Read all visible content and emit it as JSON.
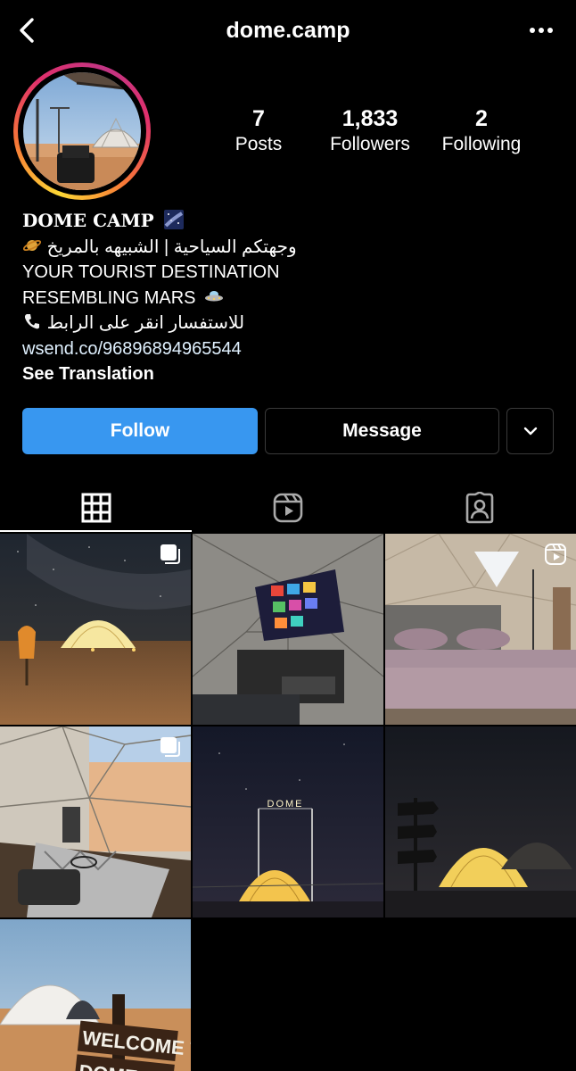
{
  "header": {
    "username": "dome.camp"
  },
  "profile": {
    "stats": [
      {
        "value": "7",
        "label": "Posts"
      },
      {
        "value": "1,833",
        "label": "Followers"
      },
      {
        "value": "2",
        "label": "Following"
      }
    ],
    "bio": {
      "name": "DOME CAMP",
      "line_ar_1": "وجهتكم السياحية | الشبيهه بالمريخ",
      "line_en_1": "YOUR TOURIST DESTINATION",
      "line_en_2": "RESEMBLING MARS",
      "line_ar_2": "للاستفسار انقر على الرابط",
      "link": "wsend.co/96896894965544",
      "see_translation": "See Translation"
    },
    "colors": {
      "follow_button": "#3897f0"
    }
  },
  "actions": {
    "follow_label": "Follow",
    "message_label": "Message"
  },
  "tabs": [
    {
      "icon": "grid-icon",
      "active": true
    },
    {
      "icon": "reels-icon",
      "active": false
    },
    {
      "icon": "tagged-icon",
      "active": false
    }
  ],
  "posts": [
    {
      "subject": "dome at night under milky way",
      "badge": "carousel-icon"
    },
    {
      "subject": "dome interior with projector screen",
      "badge": ""
    },
    {
      "subject": "dome bedroom",
      "badge": "reels-icon"
    },
    {
      "subject": "dome interior lounge",
      "badge": "carousel-icon"
    },
    {
      "subject": "DOME sign at night",
      "badge": ""
    },
    {
      "subject": "lit dome with signpost at night",
      "badge": ""
    },
    {
      "subject": "white dome with welcome sign",
      "badge": ""
    }
  ],
  "post_text": {
    "sign_dome": "DOME",
    "sign_welcome_1": "WELCOME TO",
    "sign_welcome_2": "DOME CA"
  }
}
